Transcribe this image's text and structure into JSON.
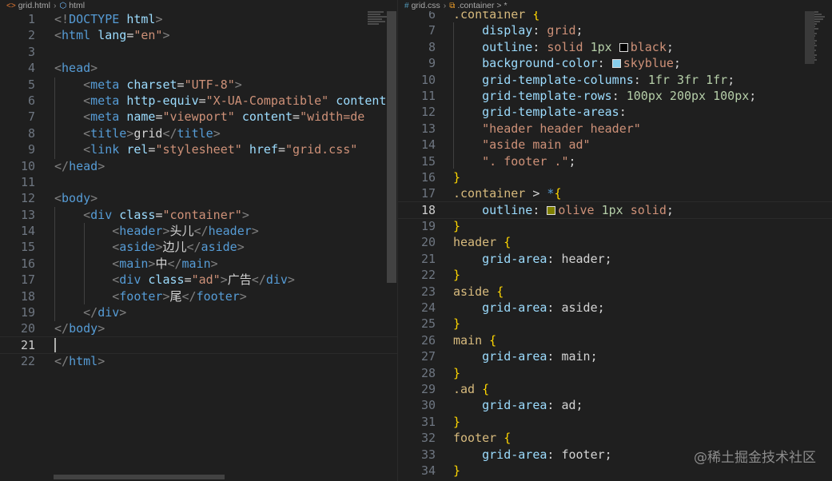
{
  "left": {
    "breadcrumb": {
      "file": "grid.html",
      "symbol": "html"
    },
    "lines": [
      {
        "n": "1",
        "code": [
          [
            "t",
            "<!"
          ],
          [
            "tag",
            "DOCTYPE"
          ],
          [
            "txt",
            " "
          ],
          [
            "attr",
            "html"
          ],
          [
            "t",
            ">"
          ]
        ]
      },
      {
        "n": "2",
        "code": [
          [
            "t",
            "<"
          ],
          [
            "tag",
            "html"
          ],
          [
            "txt",
            " "
          ],
          [
            "attr",
            "lang"
          ],
          [
            "txt",
            "="
          ],
          [
            "str",
            "\"en\""
          ],
          [
            "t",
            ">"
          ]
        ]
      },
      {
        "n": "3",
        "code": []
      },
      {
        "n": "4",
        "code": [
          [
            "t",
            "<"
          ],
          [
            "tag",
            "head"
          ],
          [
            "t",
            ">"
          ]
        ]
      },
      {
        "n": "5",
        "code": [
          [
            "txt",
            "    "
          ],
          [
            "t",
            "<"
          ],
          [
            "tag",
            "meta"
          ],
          [
            "txt",
            " "
          ],
          [
            "attr",
            "charset"
          ],
          [
            "txt",
            "="
          ],
          [
            "str",
            "\"UTF-8\""
          ],
          [
            "t",
            ">"
          ]
        ]
      },
      {
        "n": "6",
        "code": [
          [
            "txt",
            "    "
          ],
          [
            "t",
            "<"
          ],
          [
            "tag",
            "meta"
          ],
          [
            "txt",
            " "
          ],
          [
            "attr",
            "http-equiv"
          ],
          [
            "txt",
            "="
          ],
          [
            "str",
            "\"X-UA-Compatible\""
          ],
          [
            "txt",
            " "
          ],
          [
            "attr",
            "content"
          ]
        ]
      },
      {
        "n": "7",
        "code": [
          [
            "txt",
            "    "
          ],
          [
            "t",
            "<"
          ],
          [
            "tag",
            "meta"
          ],
          [
            "txt",
            " "
          ],
          [
            "attr",
            "name"
          ],
          [
            "txt",
            "="
          ],
          [
            "str",
            "\"viewport\""
          ],
          [
            "txt",
            " "
          ],
          [
            "attr",
            "content"
          ],
          [
            "txt",
            "="
          ],
          [
            "str",
            "\"width=de"
          ]
        ]
      },
      {
        "n": "8",
        "code": [
          [
            "txt",
            "    "
          ],
          [
            "t",
            "<"
          ],
          [
            "tag",
            "title"
          ],
          [
            "t",
            ">"
          ],
          [
            "txt",
            "grid"
          ],
          [
            "t",
            "</"
          ],
          [
            "tag",
            "title"
          ],
          [
            "t",
            ">"
          ]
        ]
      },
      {
        "n": "9",
        "code": [
          [
            "txt",
            "    "
          ],
          [
            "t",
            "<"
          ],
          [
            "tag",
            "link"
          ],
          [
            "txt",
            " "
          ],
          [
            "attr",
            "rel"
          ],
          [
            "txt",
            "="
          ],
          [
            "str",
            "\"stylesheet\""
          ],
          [
            "txt",
            " "
          ],
          [
            "attr",
            "href"
          ],
          [
            "txt",
            "="
          ],
          [
            "str",
            "\"grid.css\""
          ]
        ]
      },
      {
        "n": "10",
        "code": [
          [
            "t",
            "</"
          ],
          [
            "tag",
            "head"
          ],
          [
            "t",
            ">"
          ]
        ]
      },
      {
        "n": "11",
        "code": []
      },
      {
        "n": "12",
        "code": [
          [
            "t",
            "<"
          ],
          [
            "tag",
            "body"
          ],
          [
            "t",
            ">"
          ]
        ]
      },
      {
        "n": "13",
        "code": [
          [
            "txt",
            "    "
          ],
          [
            "t",
            "<"
          ],
          [
            "tag",
            "div"
          ],
          [
            "txt",
            " "
          ],
          [
            "attr",
            "class"
          ],
          [
            "txt",
            "="
          ],
          [
            "str",
            "\"container\""
          ],
          [
            "t",
            ">"
          ]
        ]
      },
      {
        "n": "14",
        "code": [
          [
            "txt",
            "        "
          ],
          [
            "t",
            "<"
          ],
          [
            "tag",
            "header"
          ],
          [
            "t",
            ">"
          ],
          [
            "txt",
            "头儿"
          ],
          [
            "t",
            "</"
          ],
          [
            "tag",
            "header"
          ],
          [
            "t",
            ">"
          ]
        ]
      },
      {
        "n": "15",
        "code": [
          [
            "txt",
            "        "
          ],
          [
            "t",
            "<"
          ],
          [
            "tag",
            "aside"
          ],
          [
            "t",
            ">"
          ],
          [
            "txt",
            "边儿"
          ],
          [
            "t",
            "</"
          ],
          [
            "tag",
            "aside"
          ],
          [
            "t",
            ">"
          ]
        ]
      },
      {
        "n": "16",
        "code": [
          [
            "txt",
            "        "
          ],
          [
            "t",
            "<"
          ],
          [
            "tag",
            "main"
          ],
          [
            "t",
            ">"
          ],
          [
            "txt",
            "中"
          ],
          [
            "t",
            "</"
          ],
          [
            "tag",
            "main"
          ],
          [
            "t",
            ">"
          ]
        ]
      },
      {
        "n": "17",
        "code": [
          [
            "txt",
            "        "
          ],
          [
            "t",
            "<"
          ],
          [
            "tag",
            "div"
          ],
          [
            "txt",
            " "
          ],
          [
            "attr",
            "class"
          ],
          [
            "txt",
            "="
          ],
          [
            "str",
            "\"ad\""
          ],
          [
            "t",
            ">"
          ],
          [
            "txt",
            "广告"
          ],
          [
            "t",
            "</"
          ],
          [
            "tag",
            "div"
          ],
          [
            "t",
            ">"
          ]
        ]
      },
      {
        "n": "18",
        "code": [
          [
            "txt",
            "        "
          ],
          [
            "t",
            "<"
          ],
          [
            "tag",
            "footer"
          ],
          [
            "t",
            ">"
          ],
          [
            "txt",
            "尾"
          ],
          [
            "t",
            "</"
          ],
          [
            "tag",
            "footer"
          ],
          [
            "t",
            ">"
          ]
        ]
      },
      {
        "n": "19",
        "code": [
          [
            "txt",
            "    "
          ],
          [
            "t",
            "</"
          ],
          [
            "tag",
            "div"
          ],
          [
            "t",
            ">"
          ]
        ]
      },
      {
        "n": "20",
        "code": [
          [
            "t",
            "</"
          ],
          [
            "tag",
            "body"
          ],
          [
            "t",
            ">"
          ]
        ]
      },
      {
        "n": "21",
        "code": [],
        "current": true
      },
      {
        "n": "22",
        "code": [
          [
            "t",
            "</"
          ],
          [
            "tag",
            "html"
          ],
          [
            "t",
            ">"
          ]
        ]
      }
    ]
  },
  "right": {
    "breadcrumb": {
      "file": "grid.css",
      "symbol": ".container > *"
    },
    "lines": [
      {
        "n": "6",
        "code": [
          [
            "sel",
            ".container"
          ],
          [
            "txt",
            " "
          ],
          [
            "br",
            "{"
          ]
        ]
      },
      {
        "n": "7",
        "code": [
          [
            "txt",
            "    "
          ],
          [
            "prop",
            "display"
          ],
          [
            "pun",
            ": "
          ],
          [
            "val",
            "grid"
          ],
          [
            "pun",
            ";"
          ]
        ]
      },
      {
        "n": "8",
        "code": [
          [
            "txt",
            "    "
          ],
          [
            "prop",
            "outline"
          ],
          [
            "pun",
            ": "
          ],
          [
            "val",
            "solid "
          ],
          [
            "num",
            "1px"
          ],
          [
            "txt",
            " "
          ],
          [
            "swatch",
            "#000000"
          ],
          [
            "val",
            "black"
          ],
          [
            "pun",
            ";"
          ]
        ]
      },
      {
        "n": "9",
        "code": [
          [
            "txt",
            "    "
          ],
          [
            "prop",
            "background-color"
          ],
          [
            "pun",
            ": "
          ],
          [
            "swatch",
            "#87ceeb"
          ],
          [
            "val",
            "skyblue"
          ],
          [
            "pun",
            ";"
          ]
        ]
      },
      {
        "n": "10",
        "code": [
          [
            "txt",
            "    "
          ],
          [
            "prop",
            "grid-template-columns"
          ],
          [
            "pun",
            ": "
          ],
          [
            "num",
            "1fr 3fr 1fr"
          ],
          [
            "pun",
            ";"
          ]
        ]
      },
      {
        "n": "11",
        "code": [
          [
            "txt",
            "    "
          ],
          [
            "prop",
            "grid-template-rows"
          ],
          [
            "pun",
            ": "
          ],
          [
            "num",
            "100px 200px 100px"
          ],
          [
            "pun",
            ";"
          ]
        ]
      },
      {
        "n": "12",
        "code": [
          [
            "txt",
            "    "
          ],
          [
            "prop",
            "grid-template-areas"
          ],
          [
            "pun",
            ":"
          ]
        ]
      },
      {
        "n": "13",
        "code": [
          [
            "txt",
            "    "
          ],
          [
            "val",
            "\"header header header\""
          ]
        ]
      },
      {
        "n": "14",
        "code": [
          [
            "txt",
            "    "
          ],
          [
            "val",
            "\"aside main ad\""
          ]
        ]
      },
      {
        "n": "15",
        "code": [
          [
            "txt",
            "    "
          ],
          [
            "val",
            "\". footer .\""
          ],
          [
            "pun",
            ";"
          ]
        ]
      },
      {
        "n": "16",
        "code": [
          [
            "br",
            "}"
          ]
        ]
      },
      {
        "n": "17",
        "code": [
          [
            "sel",
            ".container"
          ],
          [
            "txt",
            " > "
          ],
          [
            "star",
            "*"
          ],
          [
            "br",
            "{"
          ]
        ]
      },
      {
        "n": "18",
        "code": [
          [
            "txt",
            "    "
          ],
          [
            "prop",
            "outline"
          ],
          [
            "pun",
            ": "
          ],
          [
            "swatch",
            "#808000"
          ],
          [
            "val",
            "olive "
          ],
          [
            "num",
            "1px"
          ],
          [
            "val",
            " solid"
          ],
          [
            "pun",
            ";"
          ]
        ],
        "current": true
      },
      {
        "n": "19",
        "code": [
          [
            "br",
            "}"
          ]
        ]
      },
      {
        "n": "20",
        "code": [
          [
            "sel",
            "header"
          ],
          [
            "txt",
            " "
          ],
          [
            "br",
            "{"
          ]
        ]
      },
      {
        "n": "21",
        "code": [
          [
            "txt",
            "    "
          ],
          [
            "prop",
            "grid-area"
          ],
          [
            "pun",
            ": "
          ],
          [
            "txt",
            "header"
          ],
          [
            "pun",
            ";"
          ]
        ]
      },
      {
        "n": "22",
        "code": [
          [
            "br",
            "}"
          ]
        ]
      },
      {
        "n": "23",
        "code": [
          [
            "sel",
            "aside"
          ],
          [
            "txt",
            " "
          ],
          [
            "br",
            "{"
          ]
        ]
      },
      {
        "n": "24",
        "code": [
          [
            "txt",
            "    "
          ],
          [
            "prop",
            "grid-area"
          ],
          [
            "pun",
            ": "
          ],
          [
            "txt",
            "aside"
          ],
          [
            "pun",
            ";"
          ]
        ]
      },
      {
        "n": "25",
        "code": [
          [
            "br",
            "}"
          ]
        ]
      },
      {
        "n": "26",
        "code": [
          [
            "sel",
            "main"
          ],
          [
            "txt",
            " "
          ],
          [
            "br",
            "{"
          ]
        ]
      },
      {
        "n": "27",
        "code": [
          [
            "txt",
            "    "
          ],
          [
            "prop",
            "grid-area"
          ],
          [
            "pun",
            ": "
          ],
          [
            "txt",
            "main"
          ],
          [
            "pun",
            ";"
          ]
        ]
      },
      {
        "n": "28",
        "code": [
          [
            "br",
            "}"
          ]
        ]
      },
      {
        "n": "29",
        "code": [
          [
            "sel",
            ".ad"
          ],
          [
            "txt",
            " "
          ],
          [
            "br",
            "{"
          ]
        ]
      },
      {
        "n": "30",
        "code": [
          [
            "txt",
            "    "
          ],
          [
            "prop",
            "grid-area"
          ],
          [
            "pun",
            ": "
          ],
          [
            "txt",
            "ad"
          ],
          [
            "pun",
            ";"
          ]
        ]
      },
      {
        "n": "31",
        "code": [
          [
            "br",
            "}"
          ]
        ]
      },
      {
        "n": "32",
        "code": [
          [
            "sel",
            "footer"
          ],
          [
            "txt",
            " "
          ],
          [
            "br",
            "{"
          ]
        ]
      },
      {
        "n": "33",
        "code": [
          [
            "txt",
            "    "
          ],
          [
            "prop",
            "grid-area"
          ],
          [
            "pun",
            ": "
          ],
          [
            "txt",
            "footer"
          ],
          [
            "pun",
            ";"
          ]
        ]
      },
      {
        "n": "34",
        "code": [
          [
            "br",
            "}"
          ]
        ]
      }
    ]
  },
  "watermark": "@稀土掘金技术社区",
  "icons": {
    "html_file": "html-file-icon",
    "css_file": "css-file-icon",
    "symbol": "symbol-icon"
  },
  "colors": {
    "editor_bg": "#1f1f1f"
  }
}
